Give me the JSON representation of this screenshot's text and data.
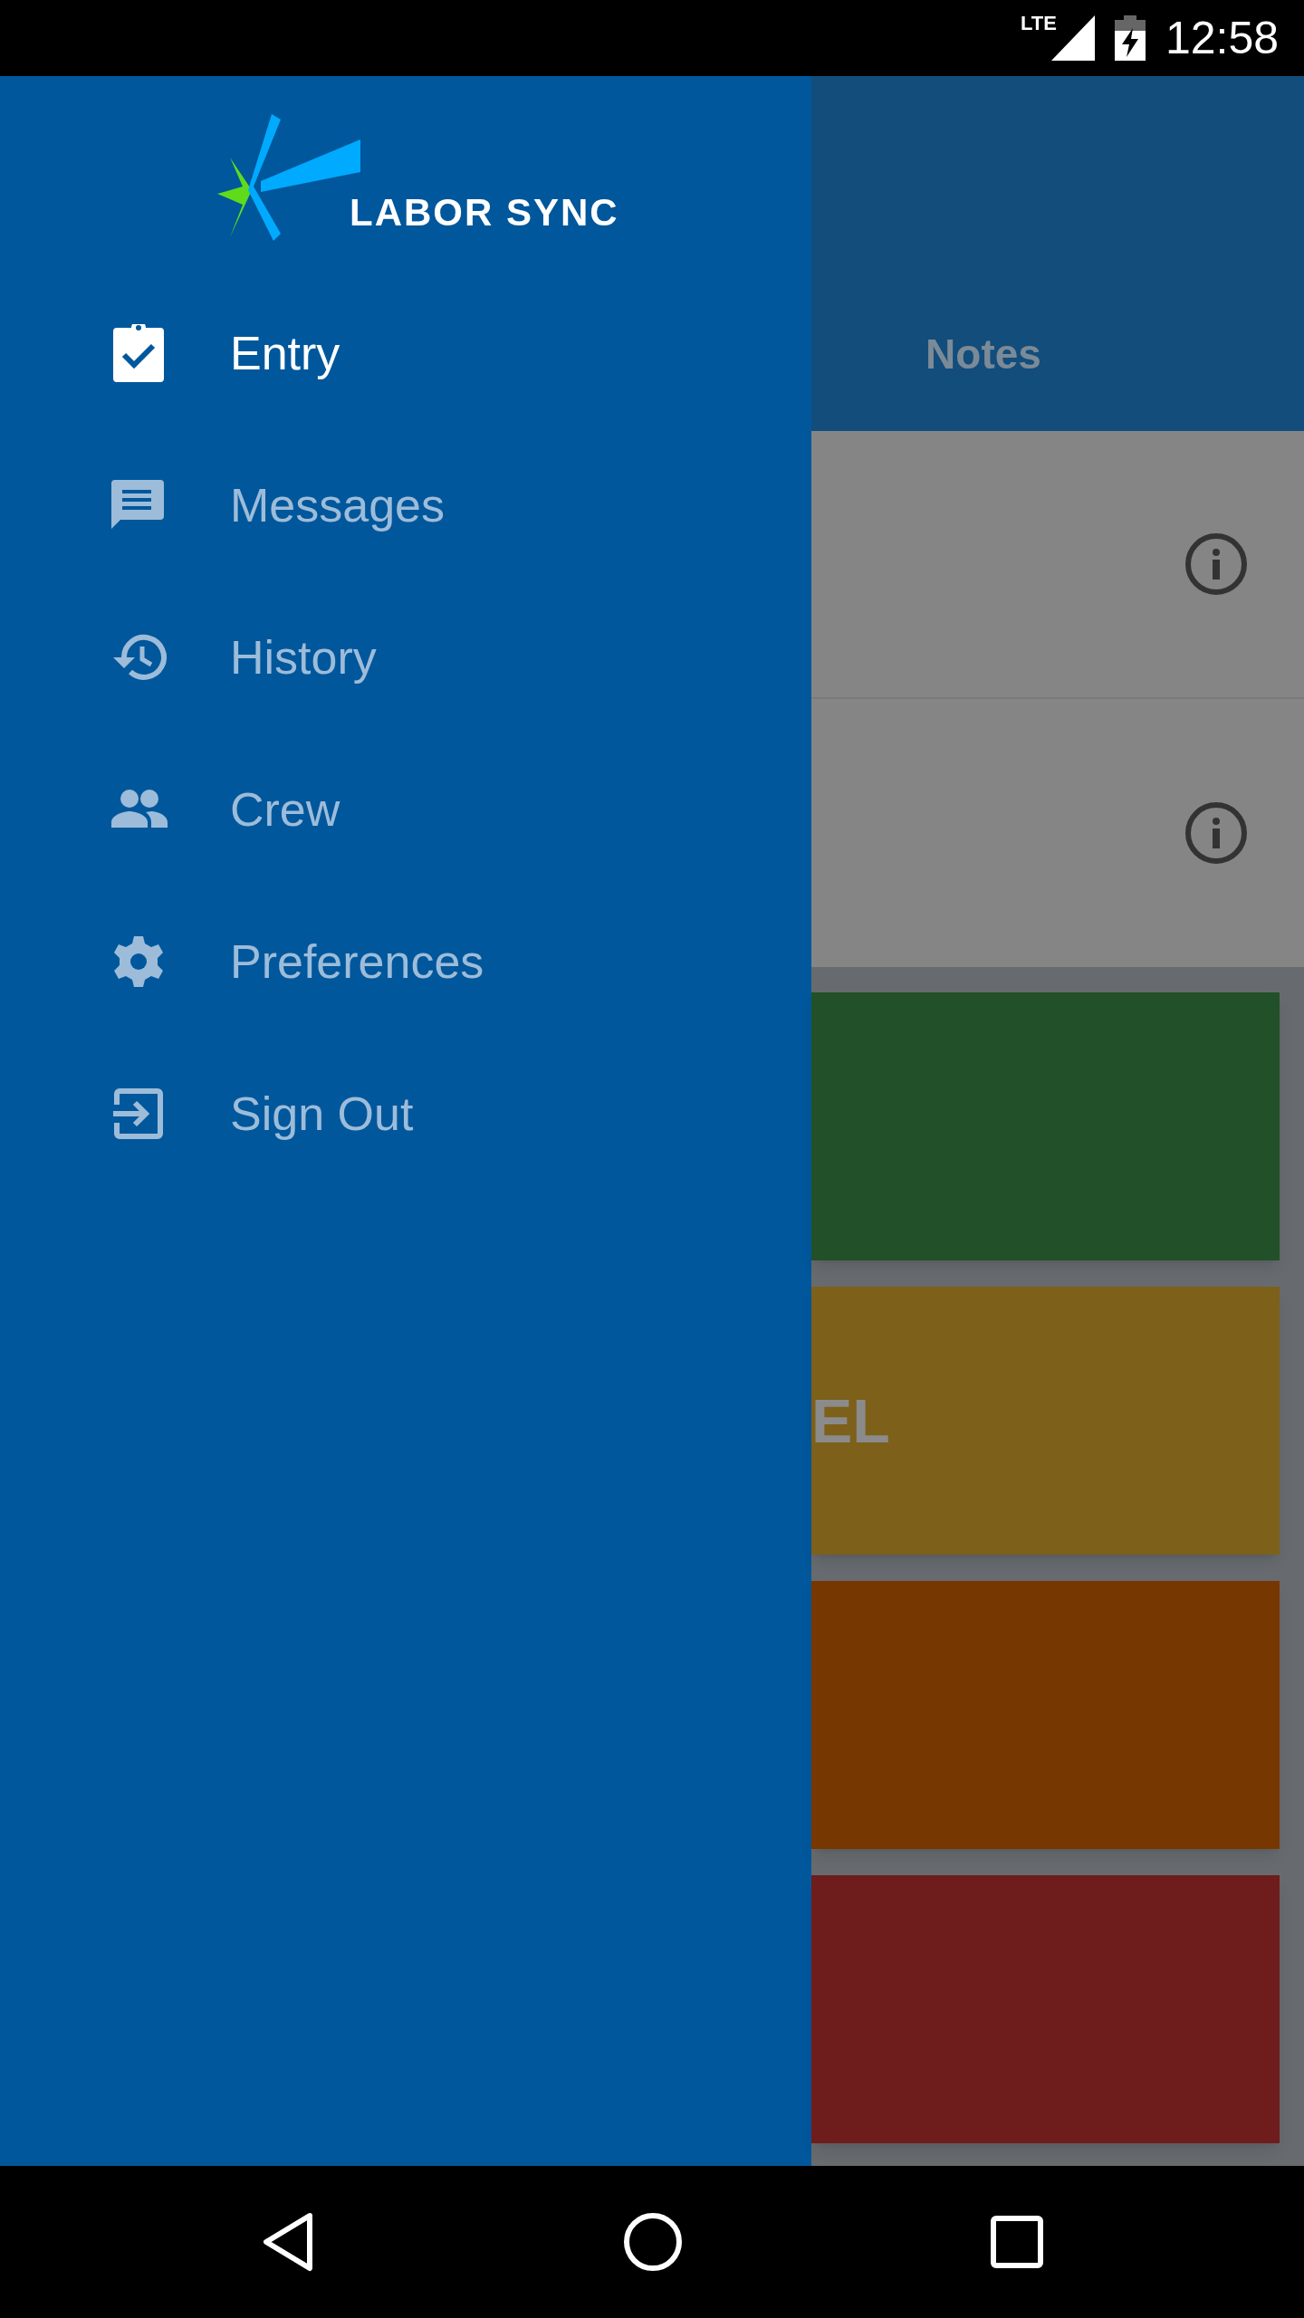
{
  "status_bar": {
    "network": "LTE",
    "time": "12:58"
  },
  "drawer": {
    "logo_text": "LABOR SYNC",
    "items": [
      {
        "label": "Entry",
        "selected": true
      },
      {
        "label": "Messages",
        "selected": false
      },
      {
        "label": "History",
        "selected": false
      },
      {
        "label": "Crew",
        "selected": false
      },
      {
        "label": "Preferences",
        "selected": false
      },
      {
        "label": "Sign Out",
        "selected": false
      }
    ]
  },
  "screen": {
    "tab": "Notes",
    "cards": [
      {
        "color": "#225028"
      },
      {
        "color": "#7d6019",
        "text": "EL"
      },
      {
        "color": "#773700"
      },
      {
        "color": "#6f1c1c"
      }
    ]
  }
}
